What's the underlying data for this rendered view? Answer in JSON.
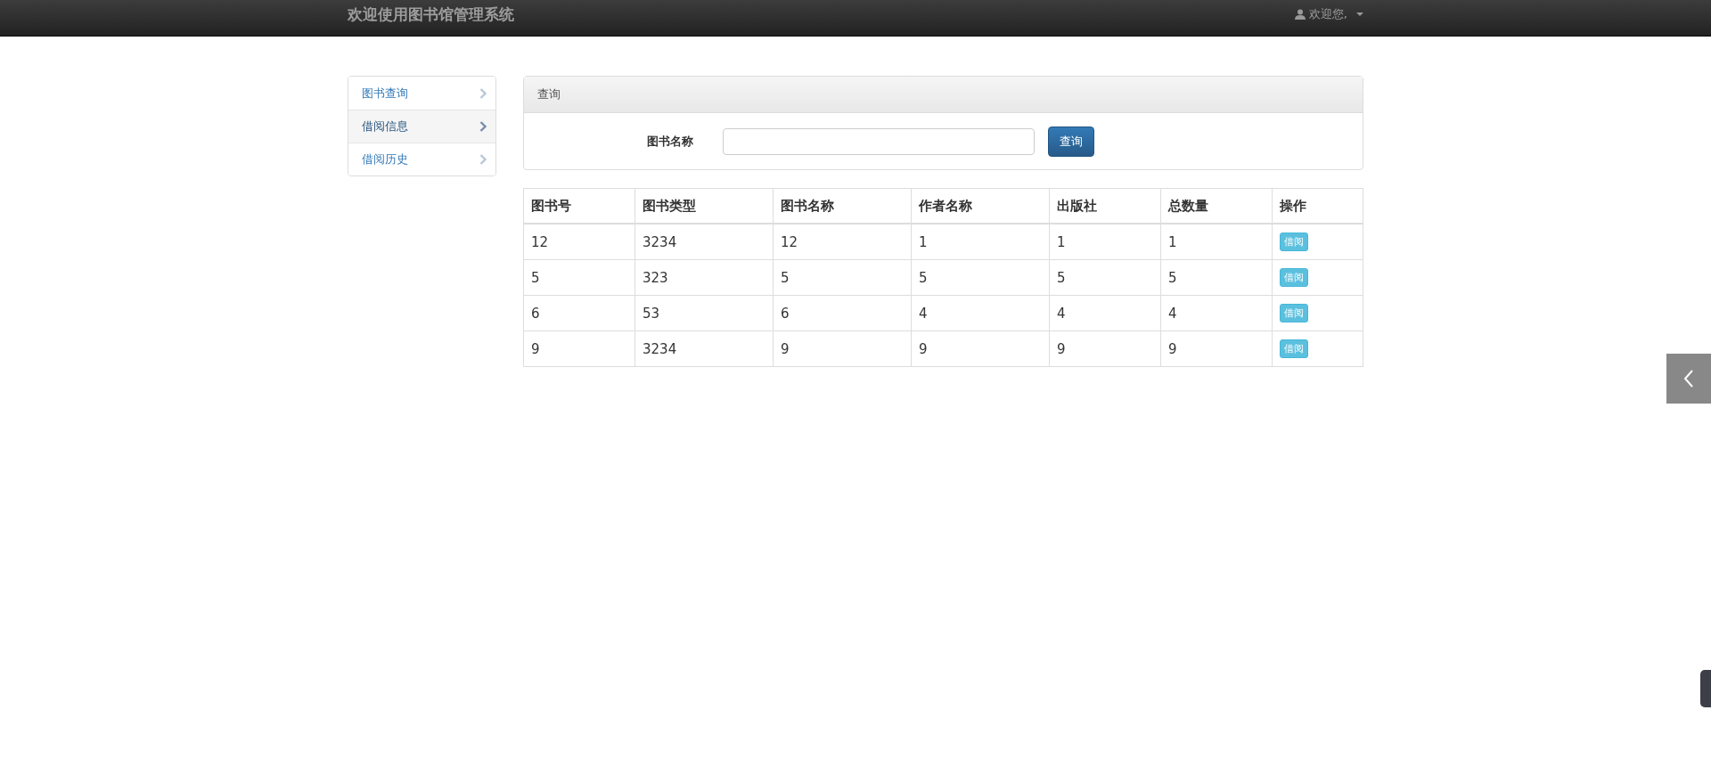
{
  "navbar": {
    "brand": "欢迎使用图书馆管理系统",
    "user_menu": "欢迎您,"
  },
  "sidebar": {
    "items": [
      {
        "label": "图书查询",
        "selected": false
      },
      {
        "label": "借阅信息",
        "selected": true
      },
      {
        "label": "借阅历史",
        "selected": false
      }
    ]
  },
  "search_panel": {
    "title": "查询",
    "field_label": "图书名称",
    "button": "查询"
  },
  "table": {
    "columns": [
      "图书号",
      "图书类型",
      "图书名称",
      "作者名称",
      "出版社",
      "总数量",
      "操作"
    ],
    "rows": [
      {
        "cells": [
          "12",
          "3234",
          "12",
          "1",
          "1",
          "1"
        ],
        "action": "借阅"
      },
      {
        "cells": [
          "5",
          "323",
          "5",
          "5",
          "5",
          "5"
        ],
        "action": "借阅"
      },
      {
        "cells": [
          "6",
          "53",
          "6",
          "4",
          "4",
          "4"
        ],
        "action": "借阅"
      },
      {
        "cells": [
          "9",
          "3234",
          "9",
          "9",
          "9",
          "9"
        ],
        "action": "借阅"
      }
    ]
  }
}
